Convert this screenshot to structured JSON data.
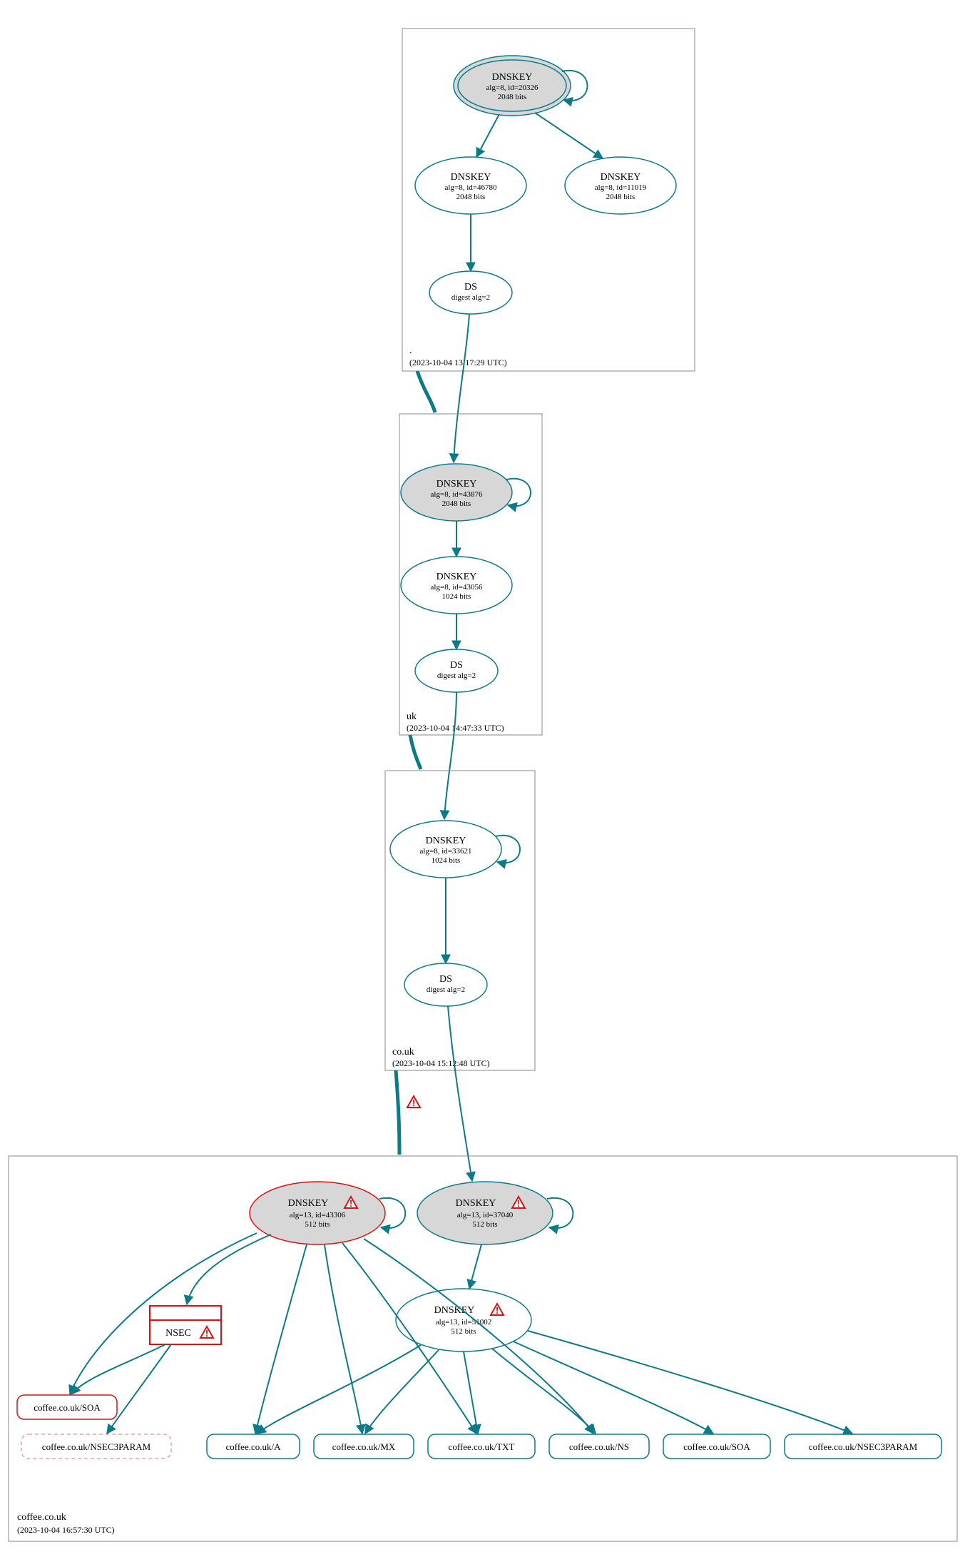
{
  "zones": {
    "root": {
      "label": ".",
      "timestamp": "(2023-10-04 13:17:29 UTC)"
    },
    "uk": {
      "label": "uk",
      "timestamp": "(2023-10-04 14:47:33 UTC)"
    },
    "couk": {
      "label": "co.uk",
      "timestamp": "(2023-10-04 15:12:48 UTC)"
    },
    "coffee": {
      "label": "coffee.co.uk",
      "timestamp": "(2023-10-04 16:57:30 UTC)"
    }
  },
  "nodes": {
    "root_ksk": {
      "title": "DNSKEY",
      "l1": "alg=8, id=20326",
      "l2": "2048 bits"
    },
    "root_zsk1": {
      "title": "DNSKEY",
      "l1": "alg=8, id=46780",
      "l2": "2048 bits"
    },
    "root_zsk2": {
      "title": "DNSKEY",
      "l1": "alg=8, id=11019",
      "l2": "2048 bits"
    },
    "root_ds": {
      "title": "DS",
      "l1": "digest alg=2"
    },
    "uk_ksk": {
      "title": "DNSKEY",
      "l1": "alg=8, id=43876",
      "l2": "2048 bits"
    },
    "uk_zsk": {
      "title": "DNSKEY",
      "l1": "alg=8, id=43056",
      "l2": "1024 bits"
    },
    "uk_ds": {
      "title": "DS",
      "l1": "digest alg=2"
    },
    "couk_key": {
      "title": "DNSKEY",
      "l1": "alg=8, id=33621",
      "l2": "1024 bits"
    },
    "couk_ds": {
      "title": "DS",
      "l1": "digest alg=2"
    },
    "cof_ksk_err": {
      "title": "DNSKEY",
      "l1": "alg=13, id=43306",
      "l2": "512 bits"
    },
    "cof_ksk_warn": {
      "title": "DNSKEY",
      "l1": "alg=13, id=37040",
      "l2": "512 bits"
    },
    "cof_zsk": {
      "title": "DNSKEY",
      "l1": "alg=13, id=51002",
      "l2": "512 bits"
    },
    "nsec": {
      "title": "NSEC"
    }
  },
  "rr": {
    "soa_err": "coffee.co.uk/SOA",
    "nsec3p_err": "coffee.co.uk/NSEC3PARAM",
    "a": "coffee.co.uk/A",
    "mx": "coffee.co.uk/MX",
    "txt": "coffee.co.uk/TXT",
    "ns": "coffee.co.uk/NS",
    "soa": "coffee.co.uk/SOA",
    "nsec3p": "coffee.co.uk/NSEC3PARAM"
  }
}
